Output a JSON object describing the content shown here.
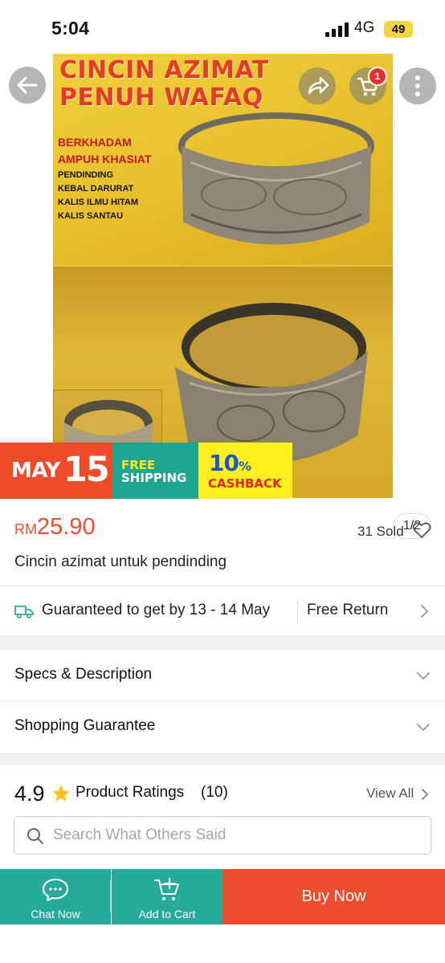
{
  "status_bar": {
    "time": "5:04",
    "network": "4G",
    "battery": "49"
  },
  "product_image": {
    "headline_line1": "CINCIN AZIMAT",
    "headline_line2": "PENUH WAFAQ",
    "red_line1": "BERKHADAM",
    "red_line2": "AMPUH KHASIAT",
    "list": [
      "PENDINDING",
      "KEBAL DARURAT",
      "KALIS ILMU HITAM",
      "KALIS SANTAU"
    ],
    "page_indicator": "1/2"
  },
  "cart": {
    "badge_count": "1"
  },
  "promo": {
    "may": "MAY",
    "day": "15",
    "free": "FREE",
    "shipping": "SHIPPING",
    "cashback_num": "10",
    "cashback_pct": "%",
    "cashback": "CASHBACK"
  },
  "price": {
    "currency": "RM",
    "amount": "25.90"
  },
  "sold": "31 Sold",
  "title": "Cincin azimat untuk pendinding",
  "delivery": {
    "text": "Guaranteed to get by 13 - 14 May",
    "return": "Free Return"
  },
  "sections": {
    "specs": "Specs & Description",
    "guarantee": "Shopping Guarantee"
  },
  "ratings": {
    "score": "4.9",
    "label": "Product Ratings",
    "count": "(10)",
    "view_all": "View All",
    "search_placeholder": "Search What Others Said"
  },
  "bottom_bar": {
    "chat": "Chat Now",
    "add_to_cart": "Add to Cart",
    "buy": "Buy Now"
  },
  "colors": {
    "brand": "#ee4d2d",
    "teal": "#26aa99",
    "yellow": "#ffef1f"
  },
  "icons": [
    "back-arrow-icon",
    "share-icon",
    "cart-icon",
    "more-icon",
    "heart-icon",
    "truck-icon",
    "chevron-right-icon",
    "chevron-down-icon",
    "star-icon",
    "search-icon",
    "chat-icon",
    "add-cart-icon"
  ]
}
